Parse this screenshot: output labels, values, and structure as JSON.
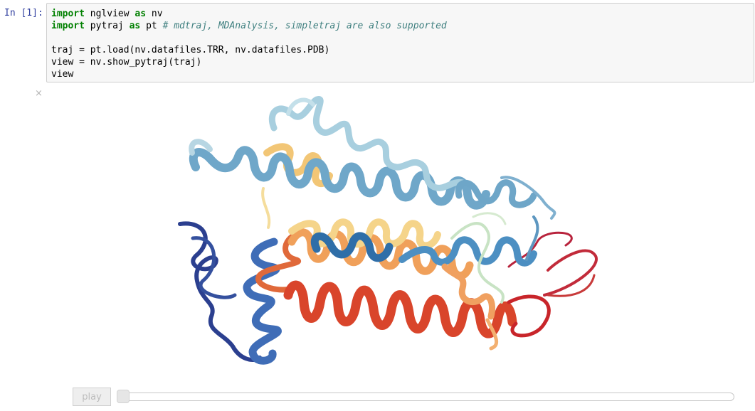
{
  "cell": {
    "prompt": "In [1]:",
    "lines": [
      {
        "kw1": "import",
        "t1": " nglview ",
        "kw2": "as",
        "t2": " nv",
        "comment": ""
      },
      {
        "kw1": "import",
        "t1": " pytraj ",
        "kw2": "as",
        "t2": " pt ",
        "comment": "# mdtraj, MDAnalysis, simpletraj are also supported"
      },
      {
        "text": ""
      },
      {
        "text": "traj = pt.load(nv.datafiles.TRR, nv.datafiles.PDB)"
      },
      {
        "text": "view = nv.show_pytraj(traj)"
      },
      {
        "text": "view"
      }
    ]
  },
  "output": {
    "close_glyph": "×",
    "viewer_icon": "protein-ribbon-render",
    "play_label": "play",
    "frame_fraction": 0
  },
  "colors": {
    "prompt": "#303F9F",
    "keyword": "#008000",
    "comment": "#408080",
    "cell_bg": "#f7f7f7"
  }
}
